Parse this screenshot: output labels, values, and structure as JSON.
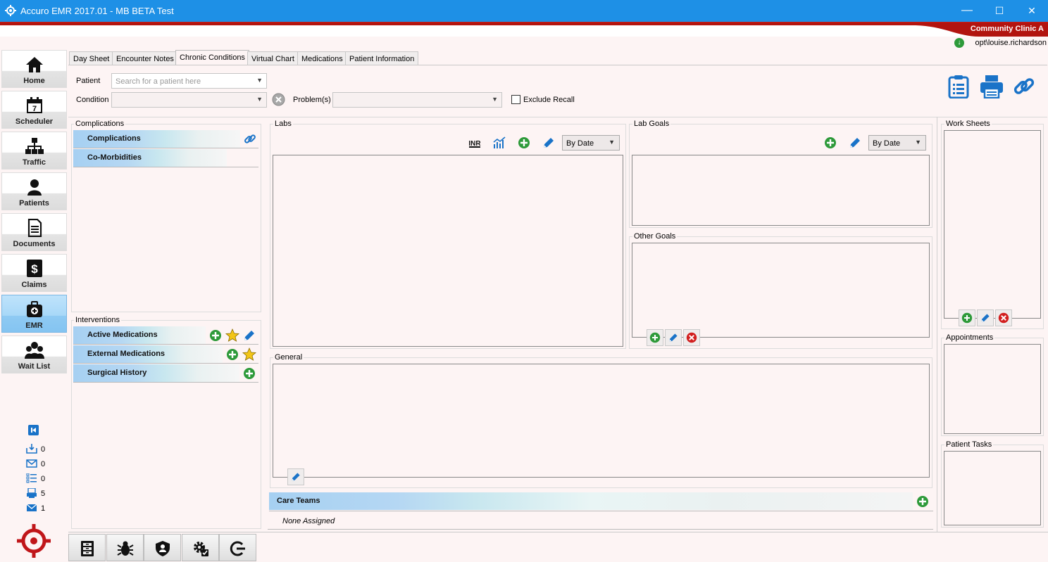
{
  "window": {
    "title": "Accuro EMR 2017.01 - MB BETA Test",
    "minimize": "—",
    "maximize": "☐",
    "close": "✕"
  },
  "clinic": "Community Clinic A",
  "user": "opt\\louise.richardson",
  "colors": {
    "titlebar": "#1e90e6",
    "brand_red": "#b2140f",
    "add_green": "#2e9a3a",
    "remove_red": "#d22020",
    "edit_blue": "#1a73c8"
  },
  "nav": {
    "items": [
      {
        "label": "Home",
        "icon": "home-icon"
      },
      {
        "label": "Scheduler",
        "icon": "calendar-icon"
      },
      {
        "label": "Traffic",
        "icon": "traffic-icon"
      },
      {
        "label": "Patients",
        "icon": "patient-icon"
      },
      {
        "label": "Documents",
        "icon": "document-icon"
      },
      {
        "label": "Claims",
        "icon": "dollar-icon"
      },
      {
        "label": "EMR",
        "icon": "medical-bag-icon"
      },
      {
        "label": "Wait List",
        "icon": "group-icon"
      }
    ],
    "counters": [
      {
        "icon": "inbox-icon",
        "value": "0"
      },
      {
        "icon": "mail-icon",
        "value": "0"
      },
      {
        "icon": "tasks-icon",
        "value": "0"
      },
      {
        "icon": "print-queue-icon",
        "value": "5"
      },
      {
        "icon": "messages-icon",
        "value": "1"
      }
    ]
  },
  "tabs": [
    "Day Sheet",
    "Encounter Notes",
    "Chronic Conditions",
    "Virtual Chart",
    "Medications",
    "Patient Information"
  ],
  "filters": {
    "patient_label": "Patient",
    "patient_placeholder": "Search for a patient here",
    "condition_label": "Condition",
    "problems_label": "Problem(s)",
    "exclude_recall": "Exclude Recall"
  },
  "complications": {
    "title": "Complications",
    "rows": [
      "Complications",
      "Co-Morbidities"
    ]
  },
  "interventions": {
    "title": "Interventions",
    "rows": [
      "Active Medications",
      "External Medications",
      "Surgical History"
    ]
  },
  "labs": {
    "title": "Labs",
    "sort": "By Date",
    "inr_label": "INR"
  },
  "lab_goals": {
    "title": "Lab Goals",
    "sort": "By Date"
  },
  "other_goals": {
    "title": "Other Goals"
  },
  "general": {
    "title": "General"
  },
  "care_teams": {
    "title": "Care Teams",
    "empty": "None Assigned"
  },
  "work_sheets": {
    "title": "Work Sheets"
  },
  "appointments": {
    "title": "Appointments"
  },
  "patient_tasks": {
    "title": "Patient Tasks"
  }
}
